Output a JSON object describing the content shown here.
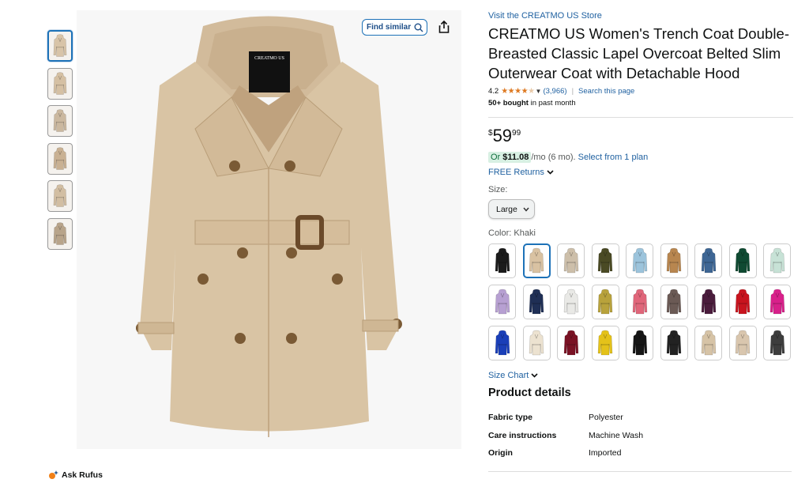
{
  "colors": {
    "link": "#2162a1",
    "star": "#de7921",
    "selected_border": "#1d72b8",
    "deal_bg": "#d8f0e3"
  },
  "find_similar": {
    "label": "Find similar",
    "icon": "search-icon"
  },
  "share": {
    "icon": "share-icon"
  },
  "ask_rufus": {
    "label": "Ask Rufus",
    "icon": "rufus-icon"
  },
  "thumbnails": [
    {
      "name": "thumb-front-view",
      "color": "#d8c4a8"
    },
    {
      "name": "thumb-hood-view",
      "color": "#d5c0a3"
    },
    {
      "name": "thumb-detail-collage",
      "color": "#cbb89f"
    },
    {
      "name": "thumb-features",
      "color": "#c9b193"
    },
    {
      "name": "thumb-hood-details",
      "color": "#d2bea2"
    },
    {
      "name": "thumb-fabric-details",
      "color": "#b8a48a"
    }
  ],
  "product": {
    "store_link": "Visit the CREATMO US Store",
    "title": "CREATMO US Women's Trench Coat Double-Breasted Classic Lapel Overcoat Belted Slim Outerwear Coat with Detachable Hood",
    "rating": "4.2",
    "stars_filled": 4.2,
    "review_count": "(3,966)",
    "search_page": "Search this page",
    "bought_bold": "50+ bought",
    "bought_rest": " in past month",
    "price_symbol": "$",
    "price_whole": "59",
    "price_fraction": "99",
    "monthly_or": "Or ",
    "monthly_amount": "$11.08",
    "monthly_rest": " /mo (6 mo).",
    "monthly_link": "Select from 1 plan",
    "returns": "FREE Returns",
    "size_label": "Size:",
    "size_value": "Large",
    "color_label": "Color: Khaki",
    "size_chart": "Size Chart",
    "details_title": "Product details",
    "details": [
      {
        "key": "Fabric type",
        "value": "Polyester"
      },
      {
        "key": "Care instructions",
        "value": "Machine Wash"
      },
      {
        "key": "Origin",
        "value": "Imported"
      }
    ]
  },
  "swatches": [
    {
      "name": "swatch-black",
      "color": "#1b1b1b",
      "selected": false
    },
    {
      "name": "swatch-khaki",
      "color": "#d9c2a2",
      "selected": true
    },
    {
      "name": "swatch-light-khaki",
      "color": "#cdbfaa",
      "selected": false
    },
    {
      "name": "swatch-army-green",
      "color": "#4a4a24",
      "selected": false
    },
    {
      "name": "swatch-light-blue",
      "color": "#9cc4dc",
      "selected": false
    },
    {
      "name": "swatch-camel",
      "color": "#b8864f",
      "selected": false
    },
    {
      "name": "swatch-denim-blue",
      "color": "#3e6694",
      "selected": false
    },
    {
      "name": "swatch-dark-green",
      "color": "#0f4a32",
      "selected": false
    },
    {
      "name": "swatch-mint",
      "color": "#c7e2d6",
      "selected": false
    },
    {
      "name": "swatch-lavender",
      "color": "#b7a0d2",
      "selected": false
    },
    {
      "name": "swatch-navy",
      "color": "#1f2f55",
      "selected": false
    },
    {
      "name": "swatch-white",
      "color": "#e9e9e6",
      "selected": false
    },
    {
      "name": "swatch-mustard",
      "color": "#b8a23c",
      "selected": false
    },
    {
      "name": "swatch-rose",
      "color": "#e0667a",
      "selected": false
    },
    {
      "name": "swatch-plaid",
      "color": "#6b5a55",
      "selected": false
    },
    {
      "name": "swatch-purple",
      "color": "#4a1c3c",
      "selected": false
    },
    {
      "name": "swatch-red",
      "color": "#c8141e",
      "selected": false
    },
    {
      "name": "swatch-hot-pink",
      "color": "#d8208a",
      "selected": false
    },
    {
      "name": "swatch-royal-blue",
      "color": "#1a3fb8",
      "selected": false
    },
    {
      "name": "swatch-beige",
      "color": "#ece2d0",
      "selected": false
    },
    {
      "name": "swatch-burgundy",
      "color": "#7a1224",
      "selected": false
    },
    {
      "name": "swatch-yellow",
      "color": "#e4c21a",
      "selected": false
    },
    {
      "name": "swatch-black-2",
      "color": "#161616",
      "selected": false
    },
    {
      "name": "swatch-black-3",
      "color": "#222222",
      "selected": false
    },
    {
      "name": "swatch-tan-2",
      "color": "#d6c3a6",
      "selected": false
    },
    {
      "name": "swatch-nude",
      "color": "#d9c6ae",
      "selected": false
    },
    {
      "name": "swatch-charcoal",
      "color": "#3d3d3d",
      "selected": false
    }
  ]
}
